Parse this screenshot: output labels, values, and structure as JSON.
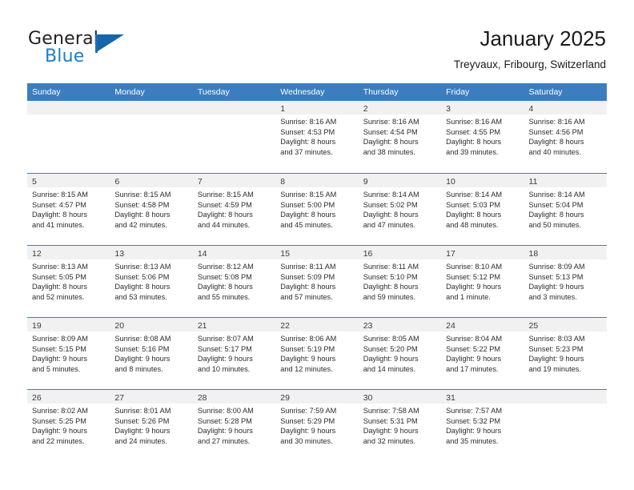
{
  "brand": {
    "name_top": "General",
    "name_bottom": "Blue",
    "accent_color": "#1565a8"
  },
  "header": {
    "title": "January 2025",
    "subtitle": "Treyvaux, Fribourg, Switzerland"
  },
  "calendar": {
    "header_color": "#3a7ebf",
    "daynum_strip_color": "#f1f1f1",
    "weekdays": [
      "Sunday",
      "Monday",
      "Tuesday",
      "Wednesday",
      "Thursday",
      "Friday",
      "Saturday"
    ],
    "weeks": [
      [
        {
          "day": "",
          "sunrise": "",
          "sunset": "",
          "daylight_line1": "",
          "daylight_line2": ""
        },
        {
          "day": "",
          "sunrise": "",
          "sunset": "",
          "daylight_line1": "",
          "daylight_line2": ""
        },
        {
          "day": "",
          "sunrise": "",
          "sunset": "",
          "daylight_line1": "",
          "daylight_line2": ""
        },
        {
          "day": "1",
          "sunrise": "Sunrise: 8:16 AM",
          "sunset": "Sunset: 4:53 PM",
          "daylight_line1": "Daylight: 8 hours",
          "daylight_line2": "and 37 minutes."
        },
        {
          "day": "2",
          "sunrise": "Sunrise: 8:16 AM",
          "sunset": "Sunset: 4:54 PM",
          "daylight_line1": "Daylight: 8 hours",
          "daylight_line2": "and 38 minutes."
        },
        {
          "day": "3",
          "sunrise": "Sunrise: 8:16 AM",
          "sunset": "Sunset: 4:55 PM",
          "daylight_line1": "Daylight: 8 hours",
          "daylight_line2": "and 39 minutes."
        },
        {
          "day": "4",
          "sunrise": "Sunrise: 8:16 AM",
          "sunset": "Sunset: 4:56 PM",
          "daylight_line1": "Daylight: 8 hours",
          "daylight_line2": "and 40 minutes."
        }
      ],
      [
        {
          "day": "5",
          "sunrise": "Sunrise: 8:15 AM",
          "sunset": "Sunset: 4:57 PM",
          "daylight_line1": "Daylight: 8 hours",
          "daylight_line2": "and 41 minutes."
        },
        {
          "day": "6",
          "sunrise": "Sunrise: 8:15 AM",
          "sunset": "Sunset: 4:58 PM",
          "daylight_line1": "Daylight: 8 hours",
          "daylight_line2": "and 42 minutes."
        },
        {
          "day": "7",
          "sunrise": "Sunrise: 8:15 AM",
          "sunset": "Sunset: 4:59 PM",
          "daylight_line1": "Daylight: 8 hours",
          "daylight_line2": "and 44 minutes."
        },
        {
          "day": "8",
          "sunrise": "Sunrise: 8:15 AM",
          "sunset": "Sunset: 5:00 PM",
          "daylight_line1": "Daylight: 8 hours",
          "daylight_line2": "and 45 minutes."
        },
        {
          "day": "9",
          "sunrise": "Sunrise: 8:14 AM",
          "sunset": "Sunset: 5:02 PM",
          "daylight_line1": "Daylight: 8 hours",
          "daylight_line2": "and 47 minutes."
        },
        {
          "day": "10",
          "sunrise": "Sunrise: 8:14 AM",
          "sunset": "Sunset: 5:03 PM",
          "daylight_line1": "Daylight: 8 hours",
          "daylight_line2": "and 48 minutes."
        },
        {
          "day": "11",
          "sunrise": "Sunrise: 8:14 AM",
          "sunset": "Sunset: 5:04 PM",
          "daylight_line1": "Daylight: 8 hours",
          "daylight_line2": "and 50 minutes."
        }
      ],
      [
        {
          "day": "12",
          "sunrise": "Sunrise: 8:13 AM",
          "sunset": "Sunset: 5:05 PM",
          "daylight_line1": "Daylight: 8 hours",
          "daylight_line2": "and 52 minutes."
        },
        {
          "day": "13",
          "sunrise": "Sunrise: 8:13 AM",
          "sunset": "Sunset: 5:06 PM",
          "daylight_line1": "Daylight: 8 hours",
          "daylight_line2": "and 53 minutes."
        },
        {
          "day": "14",
          "sunrise": "Sunrise: 8:12 AM",
          "sunset": "Sunset: 5:08 PM",
          "daylight_line1": "Daylight: 8 hours",
          "daylight_line2": "and 55 minutes."
        },
        {
          "day": "15",
          "sunrise": "Sunrise: 8:11 AM",
          "sunset": "Sunset: 5:09 PM",
          "daylight_line1": "Daylight: 8 hours",
          "daylight_line2": "and 57 minutes."
        },
        {
          "day": "16",
          "sunrise": "Sunrise: 8:11 AM",
          "sunset": "Sunset: 5:10 PM",
          "daylight_line1": "Daylight: 8 hours",
          "daylight_line2": "and 59 minutes."
        },
        {
          "day": "17",
          "sunrise": "Sunrise: 8:10 AM",
          "sunset": "Sunset: 5:12 PM",
          "daylight_line1": "Daylight: 9 hours",
          "daylight_line2": "and 1 minute."
        },
        {
          "day": "18",
          "sunrise": "Sunrise: 8:09 AM",
          "sunset": "Sunset: 5:13 PM",
          "daylight_line1": "Daylight: 9 hours",
          "daylight_line2": "and 3 minutes."
        }
      ],
      [
        {
          "day": "19",
          "sunrise": "Sunrise: 8:09 AM",
          "sunset": "Sunset: 5:15 PM",
          "daylight_line1": "Daylight: 9 hours",
          "daylight_line2": "and 5 minutes."
        },
        {
          "day": "20",
          "sunrise": "Sunrise: 8:08 AM",
          "sunset": "Sunset: 5:16 PM",
          "daylight_line1": "Daylight: 9 hours",
          "daylight_line2": "and 8 minutes."
        },
        {
          "day": "21",
          "sunrise": "Sunrise: 8:07 AM",
          "sunset": "Sunset: 5:17 PM",
          "daylight_line1": "Daylight: 9 hours",
          "daylight_line2": "and 10 minutes."
        },
        {
          "day": "22",
          "sunrise": "Sunrise: 8:06 AM",
          "sunset": "Sunset: 5:19 PM",
          "daylight_line1": "Daylight: 9 hours",
          "daylight_line2": "and 12 minutes."
        },
        {
          "day": "23",
          "sunrise": "Sunrise: 8:05 AM",
          "sunset": "Sunset: 5:20 PM",
          "daylight_line1": "Daylight: 9 hours",
          "daylight_line2": "and 14 minutes."
        },
        {
          "day": "24",
          "sunrise": "Sunrise: 8:04 AM",
          "sunset": "Sunset: 5:22 PM",
          "daylight_line1": "Daylight: 9 hours",
          "daylight_line2": "and 17 minutes."
        },
        {
          "day": "25",
          "sunrise": "Sunrise: 8:03 AM",
          "sunset": "Sunset: 5:23 PM",
          "daylight_line1": "Daylight: 9 hours",
          "daylight_line2": "and 19 minutes."
        }
      ],
      [
        {
          "day": "26",
          "sunrise": "Sunrise: 8:02 AM",
          "sunset": "Sunset: 5:25 PM",
          "daylight_line1": "Daylight: 9 hours",
          "daylight_line2": "and 22 minutes."
        },
        {
          "day": "27",
          "sunrise": "Sunrise: 8:01 AM",
          "sunset": "Sunset: 5:26 PM",
          "daylight_line1": "Daylight: 9 hours",
          "daylight_line2": "and 24 minutes."
        },
        {
          "day": "28",
          "sunrise": "Sunrise: 8:00 AM",
          "sunset": "Sunset: 5:28 PM",
          "daylight_line1": "Daylight: 9 hours",
          "daylight_line2": "and 27 minutes."
        },
        {
          "day": "29",
          "sunrise": "Sunrise: 7:59 AM",
          "sunset": "Sunset: 5:29 PM",
          "daylight_line1": "Daylight: 9 hours",
          "daylight_line2": "and 30 minutes."
        },
        {
          "day": "30",
          "sunrise": "Sunrise: 7:58 AM",
          "sunset": "Sunset: 5:31 PM",
          "daylight_line1": "Daylight: 9 hours",
          "daylight_line2": "and 32 minutes."
        },
        {
          "day": "31",
          "sunrise": "Sunrise: 7:57 AM",
          "sunset": "Sunset: 5:32 PM",
          "daylight_line1": "Daylight: 9 hours",
          "daylight_line2": "and 35 minutes."
        },
        {
          "day": "",
          "sunrise": "",
          "sunset": "",
          "daylight_line1": "",
          "daylight_line2": ""
        }
      ]
    ]
  }
}
